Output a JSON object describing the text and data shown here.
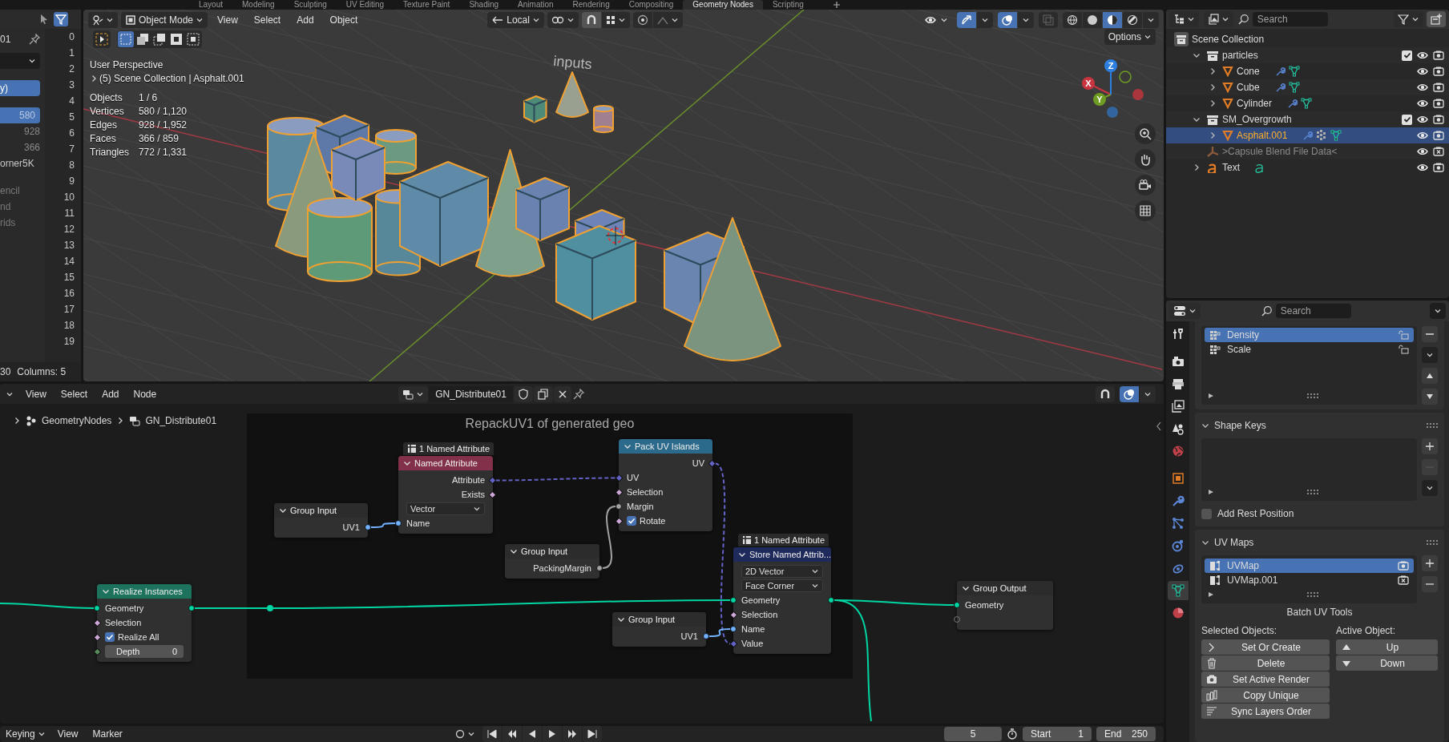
{
  "workspace_tabs": [
    {
      "label": "Layout",
      "selected": false
    },
    {
      "label": "Modeling",
      "selected": false
    },
    {
      "label": "Sculpting",
      "selected": false
    },
    {
      "label": "UV Editing",
      "selected": false
    },
    {
      "label": "Texture Paint",
      "selected": false
    },
    {
      "label": "Shading",
      "selected": false
    },
    {
      "label": "Animation",
      "selected": false
    },
    {
      "label": "Rendering",
      "selected": false
    },
    {
      "label": "Compositing",
      "selected": false
    },
    {
      "label": "Geometry Nodes",
      "selected": true
    },
    {
      "label": "Scripting",
      "selected": false
    }
  ],
  "spreadsheet": {
    "title": "01",
    "sections": [
      [
        {
          "text": "y)",
          "kind": "name",
          "selected": true
        }
      ],
      [
        {
          "text": "580",
          "kind": "count",
          "selected": true
        },
        {
          "text": "928",
          "kind": "count",
          "selected": false
        },
        {
          "text": "366",
          "kind": "count",
          "selected": false
        },
        {
          "text": "orner5K",
          "kind": "name",
          "selected": false
        }
      ],
      [
        {
          "text": "encil",
          "kind": "dim",
          "selected": false
        },
        {
          "text": "nd",
          "kind": "dim",
          "selected": false
        },
        {
          "text": "rids",
          "kind": "dim",
          "selected": false
        }
      ]
    ],
    "row_numbers": [
      "0",
      "1",
      "2",
      "3",
      "4",
      "5",
      "6",
      "7",
      "8",
      "9",
      "10",
      "11",
      "12",
      "13",
      "14",
      "15",
      "16",
      "17",
      "18",
      "19"
    ],
    "footer": {
      "rows": "30",
      "columns": "Columns: 5"
    }
  },
  "viewport": {
    "mode": "Object Mode",
    "menus": [
      "View",
      "Select",
      "Add",
      "Object"
    ],
    "orientation": "Local",
    "options": "Options",
    "select_modes": [
      {
        "selected": true
      },
      {
        "selected": false
      },
      {
        "selected": false
      },
      {
        "selected": false
      },
      {
        "selected": false
      }
    ],
    "shading_modes": [
      {
        "selected": false
      },
      {
        "selected": false
      },
      {
        "selected": true
      },
      {
        "selected": false
      }
    ],
    "perspective": "User Perspective",
    "context": "(5) Scene Collection | Asphalt.001",
    "stats": [
      {
        "label": "Objects",
        "value": "1 / 6"
      },
      {
        "label": "Vertices",
        "value": "580 / 1,120"
      },
      {
        "label": "Edges",
        "value": "928 / 1,952"
      },
      {
        "label": "Faces",
        "value": "366 / 859"
      },
      {
        "label": "Triangles",
        "value": "772 / 1,331"
      }
    ],
    "scene_text": "inputs",
    "gizmo_axes": [
      {
        "label": "X",
        "color": "#c8343f"
      },
      {
        "label": "Y",
        "color": "#6f9c22"
      },
      {
        "label": "Z",
        "color": "#2e80e0"
      }
    ]
  },
  "outliner": {
    "search_placeholder": "Search",
    "items": [
      {
        "label": "Scene Collection",
        "kind": "scene",
        "selected": false,
        "disabled": false,
        "children": [
          {
            "label": "particles",
            "kind": "collection",
            "expanded": true,
            "checked": true,
            "selected": false,
            "disabled": false,
            "render_enabled": true,
            "children": [
              {
                "label": "Cone",
                "kind": "mesh",
                "expanded": false,
                "selected": false,
                "disabled": false,
                "render_enabled": true,
                "badges": [
                  {
                    "kind": "modifier"
                  },
                  {
                    "kind": "mesh"
                  }
                ]
              },
              {
                "label": "Cube",
                "kind": "mesh",
                "expanded": false,
                "selected": false,
                "disabled": false,
                "render_enabled": true,
                "badges": [
                  {
                    "kind": "modifier"
                  },
                  {
                    "kind": "mesh"
                  }
                ]
              },
              {
                "label": "Cylinder",
                "kind": "mesh",
                "expanded": false,
                "selected": false,
                "disabled": false,
                "render_enabled": true,
                "badges": [
                  {
                    "kind": "modifier"
                  },
                  {
                    "kind": "mesh"
                  }
                ]
              }
            ]
          },
          {
            "label": "SM_Overgrowth",
            "kind": "collection",
            "expanded": true,
            "checked": true,
            "selected": false,
            "disabled": false,
            "render_enabled": true,
            "children": [
              {
                "label": "Asphalt.001",
                "kind": "mesh",
                "expanded": false,
                "selected": true,
                "disabled": false,
                "render_enabled": true,
                "badges": [
                  {
                    "kind": "modifier"
                  },
                  {
                    "kind": "particles"
                  },
                  {
                    "kind": "mesh"
                  }
                ]
              }
            ]
          },
          {
            "label": ">Capsule Blend File Data<",
            "kind": "empty",
            "selected": false,
            "disabled": true,
            "render_enabled": false
          },
          {
            "label": "Text",
            "kind": "text",
            "expanded": false,
            "selected": false,
            "disabled": false,
            "render_enabled": true,
            "badges": [
              {
                "kind": "text"
              }
            ]
          }
        ]
      }
    ]
  },
  "properties": {
    "search_placeholder": "Search",
    "tabs": [
      {
        "selected": false
      },
      {
        "selected": false
      },
      {
        "selected": false
      },
      {
        "selected": false
      },
      {
        "selected": false
      },
      {
        "selected": false
      },
      {
        "selected": false
      },
      {
        "selected": false
      },
      {
        "selected": false
      },
      {
        "selected": false
      },
      {
        "selected": false
      },
      {
        "selected": true
      },
      {
        "selected": false
      }
    ],
    "attributes": [
      {
        "label": "Density",
        "selected": true
      },
      {
        "label": "Scale",
        "selected": false
      }
    ],
    "shape_keys": {
      "title": "Shape Keys",
      "expanded": true
    },
    "rest_position": {
      "label": "Add Rest Position",
      "checked": false
    },
    "uv_maps": {
      "title": "UV Maps",
      "expanded": true,
      "items": [
        {
          "label": "UVMap",
          "selected": true,
          "active_render": true
        },
        {
          "label": "UVMap.001",
          "selected": false,
          "active_render": false
        }
      ]
    },
    "batch_tools": {
      "title": "Batch UV Tools",
      "selected_label": "Selected Objects:",
      "active_label": "Active Object:",
      "selected_buttons": [
        {
          "label": "Set Or Create",
          "kind": "chevron"
        },
        {
          "label": "Delete",
          "kind": "trash"
        },
        {
          "label": "Set Active Render",
          "kind": "camera"
        },
        {
          "label": "Copy Unique",
          "kind": "copy"
        },
        {
          "label": "Sync Layers Order",
          "kind": "lines"
        }
      ],
      "active_buttons": [
        {
          "label": "Up",
          "kind": "up"
        },
        {
          "label": "Down",
          "kind": "down"
        }
      ]
    }
  },
  "node_editor": {
    "menus": [
      "View",
      "Select",
      "Add",
      "Node"
    ],
    "tree_name": "GN_Distribute01",
    "breadcrumb": [
      "GeometryNodes",
      "GN_Distribute01"
    ],
    "frame_label": "RepackUV1 of generated geo",
    "nodes": [
      {
        "title": "Realize Instances",
        "kind": "geometry",
        "rows": [
          {
            "label": "Geometry",
            "kind": "both",
            "socket": {
              "kind": "geometry"
            }
          },
          {
            "label": "Selection",
            "kind": "in",
            "socket": {
              "kind": "bool-field"
            }
          },
          {
            "label": "Realize All",
            "kind": "checkbox",
            "socket": {
              "kind": "bool-field"
            },
            "checked": true
          },
          {
            "label": "Depth",
            "kind": "field",
            "socket": {
              "kind": "int-field"
            },
            "value": "0"
          }
        ]
      },
      {
        "title": "Group Input",
        "kind": "group",
        "rows": [
          {
            "label": "UV1",
            "kind": "out",
            "socket": {
              "kind": "string"
            }
          }
        ]
      },
      {
        "title": "Named Attribute",
        "kind": "input",
        "badge": "1 Named Attribute",
        "rows": [
          {
            "label": "Attribute",
            "kind": "out",
            "socket": {
              "kind": "vector-field"
            }
          },
          {
            "label": "Exists",
            "kind": "out",
            "socket": {
              "kind": "bool-field"
            }
          },
          {
            "label": "Vector",
            "kind": "dropdown"
          },
          {
            "label": "Name",
            "kind": "in",
            "socket": {
              "kind": "string"
            }
          }
        ]
      },
      {
        "title": "Group Input",
        "kind": "group",
        "rows": [
          {
            "label": "PackingMargin",
            "kind": "out",
            "socket": {
              "kind": "float"
            }
          }
        ]
      },
      {
        "title": "Pack UV Islands",
        "kind": "uv",
        "rows": [
          {
            "label": "UV",
            "kind": "out",
            "socket": {
              "kind": "vector-field"
            }
          },
          {
            "label": "UV",
            "kind": "in",
            "socket": {
              "kind": "vector-field"
            }
          },
          {
            "label": "Selection",
            "kind": "in",
            "socket": {
              "kind": "bool-field"
            }
          },
          {
            "label": "Margin",
            "kind": "in",
            "socket": {
              "kind": "float"
            }
          },
          {
            "label": "Rotate",
            "kind": "checkbox",
            "socket": {
              "kind": "bool-field"
            },
            "checked": true
          }
        ]
      },
      {
        "title": "Group Input",
        "kind": "group",
        "rows": [
          {
            "label": "UV1",
            "kind": "out",
            "socket": {
              "kind": "string"
            }
          }
        ]
      },
      {
        "title": "Store Named Attrib...",
        "kind": "attribute",
        "badge": "1 Named Attribute",
        "rows": [
          {
            "label": "2D Vector",
            "kind": "dropdown"
          },
          {
            "label": "Face Corner",
            "kind": "dropdown"
          },
          {
            "label": "Geometry",
            "kind": "both",
            "socket": {
              "kind": "geometry"
            }
          },
          {
            "label": "Selection",
            "kind": "in",
            "socket": {
              "kind": "bool-field"
            }
          },
          {
            "label": "Name",
            "kind": "in",
            "socket": {
              "kind": "string"
            }
          },
          {
            "label": "Value",
            "kind": "in",
            "socket": {
              "kind": "vector-field"
            }
          }
        ]
      },
      {
        "title": "Group Output",
        "kind": "group",
        "rows": [
          {
            "label": "Geometry",
            "kind": "in",
            "socket": {
              "kind": "geometry"
            }
          },
          {
            "kind": "in",
            "socket": {
              "kind": "virtual"
            }
          }
        ]
      }
    ]
  },
  "timeline": {
    "keying": "Keying",
    "menus": [
      "View",
      "Marker"
    ],
    "auto_key": false,
    "frame": "5",
    "start_label": "Start",
    "start": "1",
    "end_label": "End",
    "end": "250"
  }
}
